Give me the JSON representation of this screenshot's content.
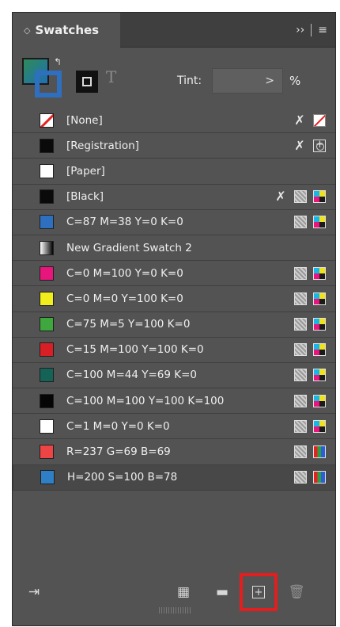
{
  "panel": {
    "tab_arrows": "◇",
    "tab_title": "Swatches",
    "menu_chevrons": "››",
    "menu_icon": "≡"
  },
  "controls": {
    "text_glyph": "T",
    "tint_label": "Tint:",
    "tint_value": ">",
    "tint_unit": "%"
  },
  "swatches": [
    {
      "name": "[None]",
      "color": "none",
      "icons": [
        "pencil-off-icon",
        "none-icon"
      ]
    },
    {
      "name": "[Registration]",
      "color": "#0a0a0a",
      "icons": [
        "pencil-off-icon",
        "registration-icon"
      ]
    },
    {
      "name": "[Paper]",
      "color": "#ffffff",
      "icons": []
    },
    {
      "name": "[Black]",
      "color": "#0a0a0a",
      "icons": [
        "pencil-off-icon",
        "process-icon",
        "cmyk-icon"
      ]
    },
    {
      "name": "C=87 M=38 Y=0 K=0",
      "color": "#2f6fc0",
      "icons": [
        "process-icon",
        "cmyk-icon"
      ]
    },
    {
      "name": "New Gradient Swatch 2",
      "color": "gradient",
      "icons": []
    },
    {
      "name": "C=0 M=100 Y=0 K=0",
      "color": "#e8157c",
      "icons": [
        "process-icon",
        "cmyk-icon"
      ]
    },
    {
      "name": "C=0 M=0 Y=100 K=0",
      "color": "#f2ee1b",
      "icons": [
        "process-icon",
        "cmyk-icon"
      ]
    },
    {
      "name": "C=75 M=5 Y=100 K=0",
      "color": "#3ea83e",
      "icons": [
        "process-icon",
        "cmyk-icon"
      ]
    },
    {
      "name": "C=15 M=100 Y=100 K=0",
      "color": "#d91f26",
      "icons": [
        "process-icon",
        "cmyk-icon"
      ]
    },
    {
      "name": "C=100 M=44 Y=69 K=0",
      "color": "#146356",
      "icons": [
        "process-icon",
        "cmyk-icon"
      ]
    },
    {
      "name": "C=100 M=100 Y=100 K=100",
      "color": "#050505",
      "icons": [
        "process-icon",
        "cmyk-icon"
      ]
    },
    {
      "name": "C=1 M=0 Y=0 K=0",
      "color": "#ffffff",
      "icons": [
        "process-icon",
        "cmyk-icon"
      ]
    },
    {
      "name": "R=237 G=69 B=69",
      "color": "#ed4545",
      "icons": [
        "process-icon",
        "rgb-icon"
      ]
    },
    {
      "name": "H=200 S=100 B=78",
      "color": "#2f7fc7",
      "icons": [
        "process-icon",
        "rgb-icon"
      ]
    }
  ],
  "footer": {
    "import_icon": "⇥",
    "view_icon": "▦",
    "folder_icon": "▬",
    "new_swatch_icon": "+",
    "delete_icon": "🗑"
  },
  "colors": {
    "panel_bg": "#535353",
    "highlight": "#e41e1e"
  }
}
